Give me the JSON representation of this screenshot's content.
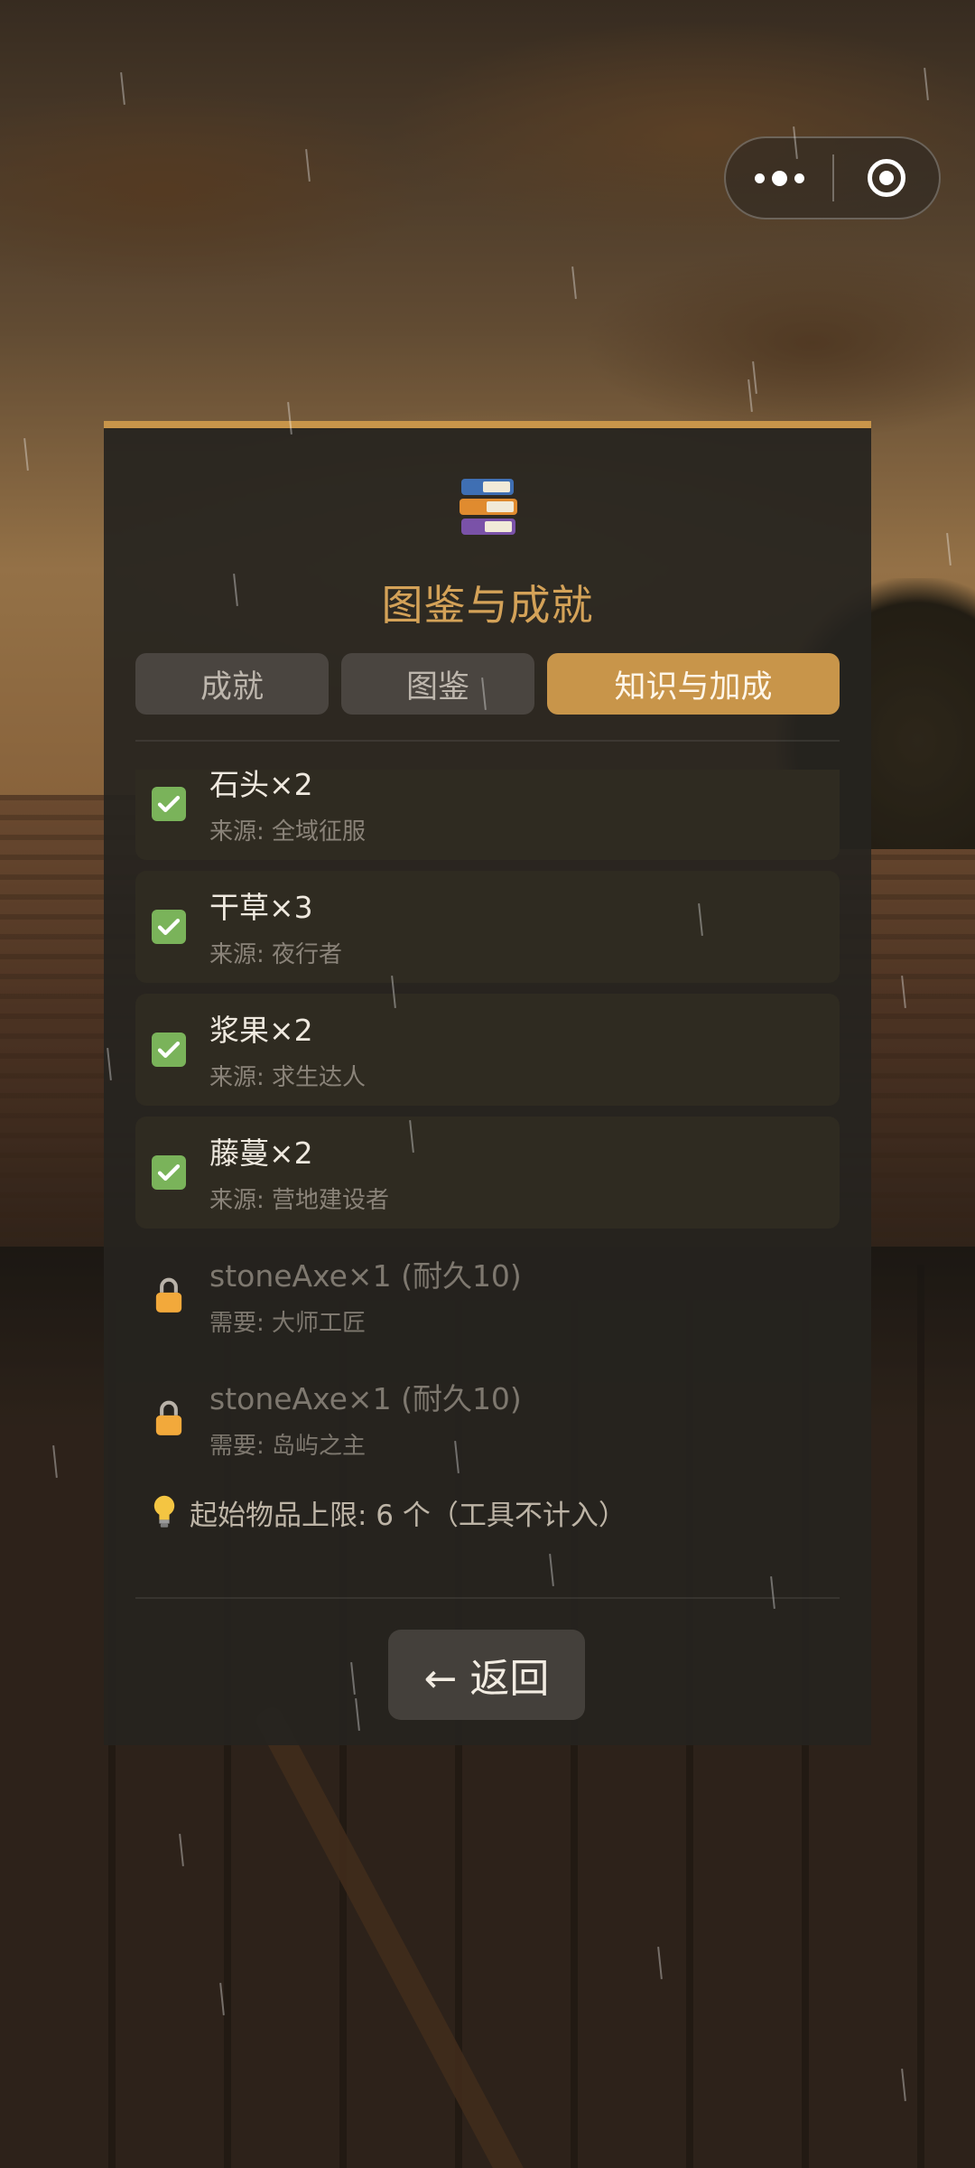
{
  "title": "图鉴与成就",
  "tabs": [
    {
      "label": "成就",
      "active": false
    },
    {
      "label": "图鉴",
      "active": false
    },
    {
      "label": "知识与加成",
      "active": true
    }
  ],
  "items": [
    {
      "name": "石头×2",
      "source": "来源: 全域征服",
      "unlocked": true
    },
    {
      "name": "干草×3",
      "source": "来源: 夜行者",
      "unlocked": true
    },
    {
      "name": "浆果×2",
      "source": "来源: 求生达人",
      "unlocked": true
    },
    {
      "name": "藤蔓×2",
      "source": "来源: 营地建设者",
      "unlocked": true
    },
    {
      "name": "stoneAxe×1 (耐久10)",
      "source": "需要: 大师工匠",
      "unlocked": false
    },
    {
      "name": "stoneAxe×1 (耐久10)",
      "source": "需要: 岛屿之主",
      "unlocked": false
    }
  ],
  "note": "起始物品上限: 6 个（工具不计入）",
  "back_label": "← 返回",
  "colors": {
    "accent": "#c8954a",
    "title": "#d4a258",
    "check": "#7ab35a",
    "panel": "#26231f"
  },
  "icons": {
    "header": "books-icon",
    "unlocked": "checkbox-checked-icon",
    "locked": "lock-icon",
    "note": "lightbulb-icon"
  }
}
